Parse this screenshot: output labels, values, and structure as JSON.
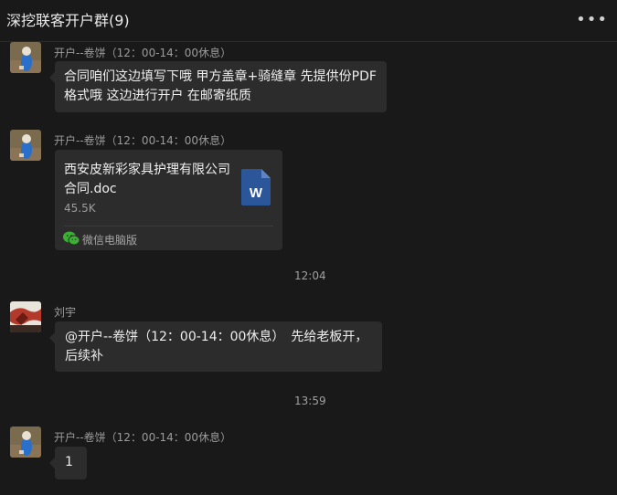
{
  "header": {
    "title": "深挖联客开户群(9)",
    "more_icon": "more-dots-icon"
  },
  "messages": [
    {
      "sender": "开户--卷饼（12：00-14：00休息）",
      "text_line1": "合同咱们这边填写下哦 甲方盖章+骑缝章 先提供份PDF",
      "text_line2": "格式哦 这边进行开户 在邮寄纸质"
    },
    {
      "sender": "开户--卷饼（12：00-14：00休息）",
      "file": {
        "name_line1": "西安皮新彩家具护理有限公司",
        "name_line2": "合同.doc",
        "size": "45.5K",
        "source": "微信电脑版",
        "file_icon_letter": "W",
        "file_icon_color": "#2b579a",
        "source_icon_color": "#3cb034"
      }
    },
    {
      "time": "12:04"
    },
    {
      "sender": "刘宇",
      "text_line1": "@开户--卷饼（12：00-14：00休息）　先给老板开，",
      "text_line2": "后续补"
    },
    {
      "time": "13:59"
    },
    {
      "sender": "开户--卷饼（12：00-14：00休息）",
      "text_line1": "1"
    }
  ]
}
